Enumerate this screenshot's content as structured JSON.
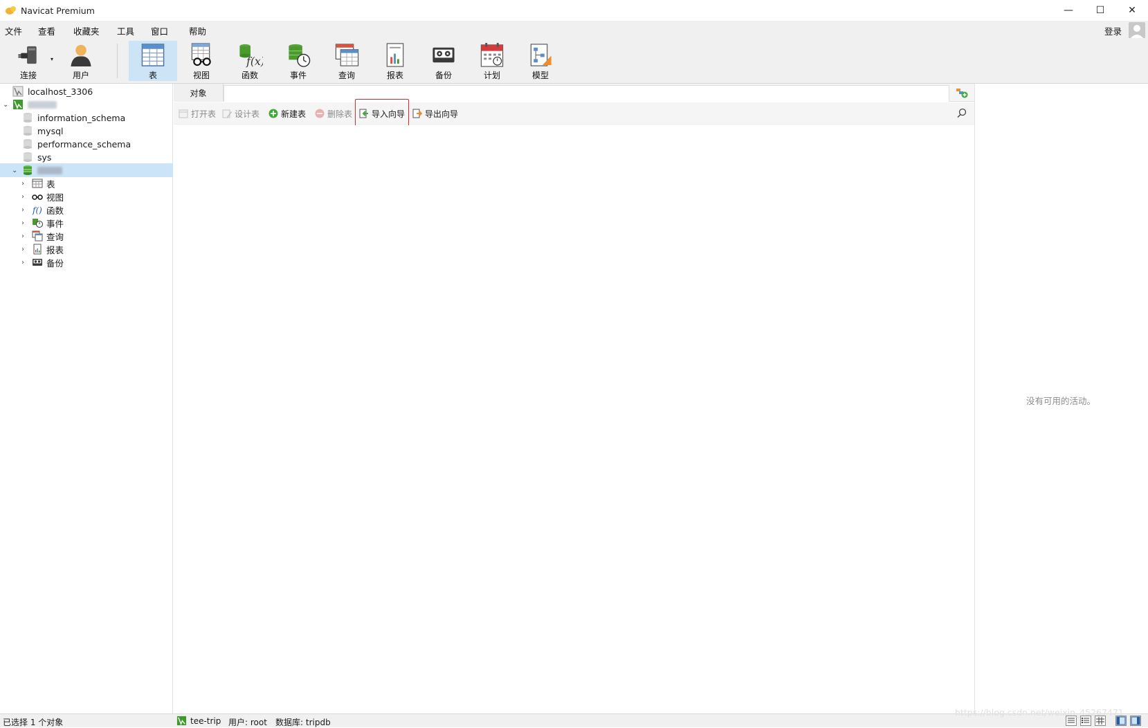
{
  "window": {
    "title": "Navicat Premium",
    "minimize": "—",
    "maximize": "☐",
    "close": "✕"
  },
  "menu": {
    "items": [
      "文件",
      "查看",
      "收藏夹",
      "工具",
      "窗口",
      "帮助"
    ],
    "login": "登录"
  },
  "toolbar": {
    "buttons": [
      {
        "label": "连接",
        "icon": "plug-icon"
      },
      {
        "label": "用户",
        "icon": "user-icon"
      },
      {
        "label": "表",
        "icon": "table-icon"
      },
      {
        "label": "视图",
        "icon": "view-glasses-icon"
      },
      {
        "label": "函数",
        "icon": "function-icon"
      },
      {
        "label": "事件",
        "icon": "event-clock-icon"
      },
      {
        "label": "查询",
        "icon": "query-icon"
      },
      {
        "label": "报表",
        "icon": "report-icon"
      },
      {
        "label": "备份",
        "icon": "backup-icon"
      },
      {
        "label": "计划",
        "icon": "calendar-icon"
      },
      {
        "label": "模型",
        "icon": "model-icon"
      }
    ],
    "active": "表"
  },
  "sidebar": {
    "connections": [
      {
        "name": "localhost_3306",
        "expanded": false
      },
      {
        "name": "",
        "expanded": true
      }
    ],
    "databases": [
      "information_schema",
      "mysql",
      "performance_schema",
      "sys"
    ],
    "selected_database": "",
    "categories": [
      "表",
      "视图",
      "函数",
      "事件",
      "查询",
      "报表",
      "备份"
    ]
  },
  "objects_tab": {
    "label": "对象"
  },
  "object_toolbar": {
    "open": "打开表",
    "design": "设计表",
    "new": "新建表",
    "delete": "删除表",
    "import": "导入向导",
    "export": "导出向导"
  },
  "right_panel": {
    "empty_text": "没有可用的活动。"
  },
  "status": {
    "selection": "已选择 1 个对象",
    "connection": "tee-trip",
    "user": "用户: root",
    "database": "数据库: tripdb"
  },
  "watermark": "https://blog.csdn.net/weixin_45267471",
  "colors": {
    "accent": "#cde4f7",
    "highlight": "#e0262b",
    "db_green": "#4aa632"
  }
}
